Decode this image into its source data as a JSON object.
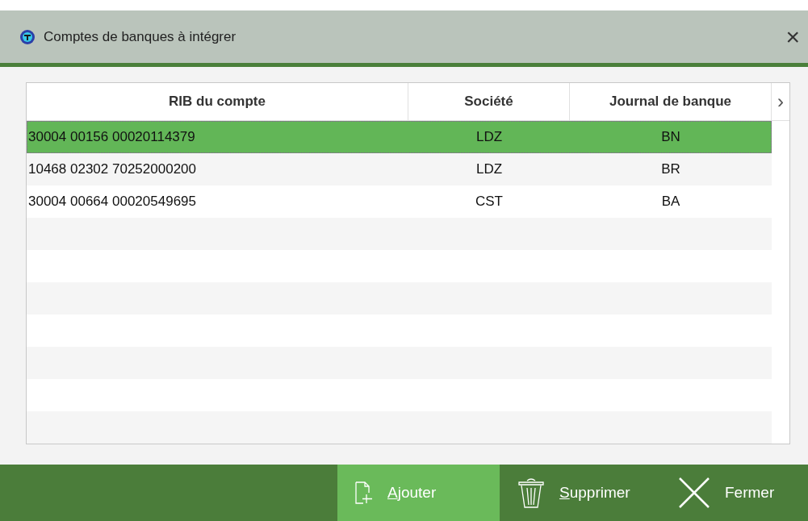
{
  "window": {
    "title": "Comptes de banques à intégrer",
    "close": "×"
  },
  "table": {
    "columns": [
      "RIB du compte",
      "Société",
      "Journal de banque"
    ],
    "scroll_arrow": "›",
    "rows": [
      {
        "cells": [
          "30004 00156 00020114379",
          "LDZ",
          "BN"
        ],
        "selected": true
      },
      {
        "cells": [
          "10468 02302 70252000200",
          "LDZ",
          "BR"
        ],
        "selected": false
      },
      {
        "cells": [
          "30004 00664 00020549695",
          "CST",
          "BA"
        ],
        "selected": false
      }
    ]
  },
  "toolbar": [
    {
      "kind": "add",
      "label": "Ajouter",
      "selected": true,
      "underline_first": true
    },
    {
      "kind": "delete",
      "label": "Supprimer",
      "selected": false,
      "underline_first": true
    },
    {
      "kind": "close",
      "label": "Fermer",
      "selected": false,
      "underline_first": false
    }
  ]
}
